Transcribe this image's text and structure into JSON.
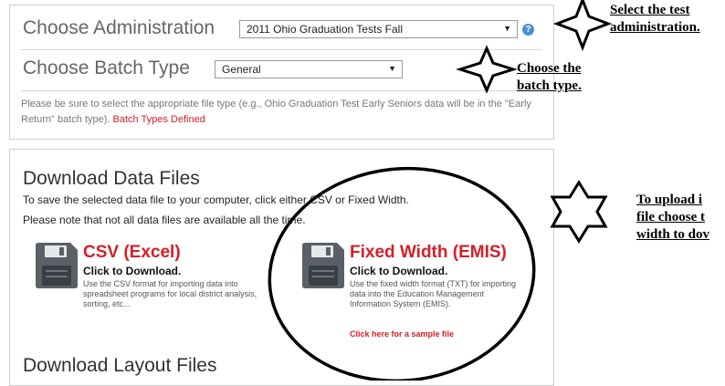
{
  "administration": {
    "label": "Choose Administration",
    "selected": "2011 Ohio Graduation Tests Fall",
    "help_icon": "question-icon"
  },
  "batch": {
    "label": "Choose Batch Type",
    "selected": "General"
  },
  "note": {
    "text": "Please be sure to select the appropriate file type (e.g., Ohio Graduation Test Early Seniors data will be in the \"Early Return\" batch type).",
    "link": "Batch Types Defined"
  },
  "download": {
    "heading": "Download Data Files",
    "line1": "To save the selected data file to your computer, click either CSV or Fixed Width.",
    "line2": "Please note that not all data files are available all the time.",
    "csv": {
      "title": "CSV (Excel)",
      "subtitle": "Click to Download.",
      "description": "Use the CSV format for importing data into spreadsheet programs for local district analysis, sorting, etc..."
    },
    "fixed": {
      "title": "Fixed Width (EMIS)",
      "subtitle": "Click to Download.",
      "description": "Use the fixed width format (TXT) for importing data into the Education Management Information System (EMIS).",
      "sample_link": "Click here for a sample file"
    },
    "layout_heading": "Download Layout Files"
  },
  "annotations": {
    "select_test_1": "Select the test",
    "select_test_2": "administration.",
    "batch_1": "Choose the",
    "batch_2": "batch type.",
    "upload_1": "To upload i",
    "upload_2": "file choose t",
    "upload_3": "width to dov"
  },
  "colors": {
    "accent_red": "#d41f27",
    "help_blue": "#4a8fd6"
  }
}
